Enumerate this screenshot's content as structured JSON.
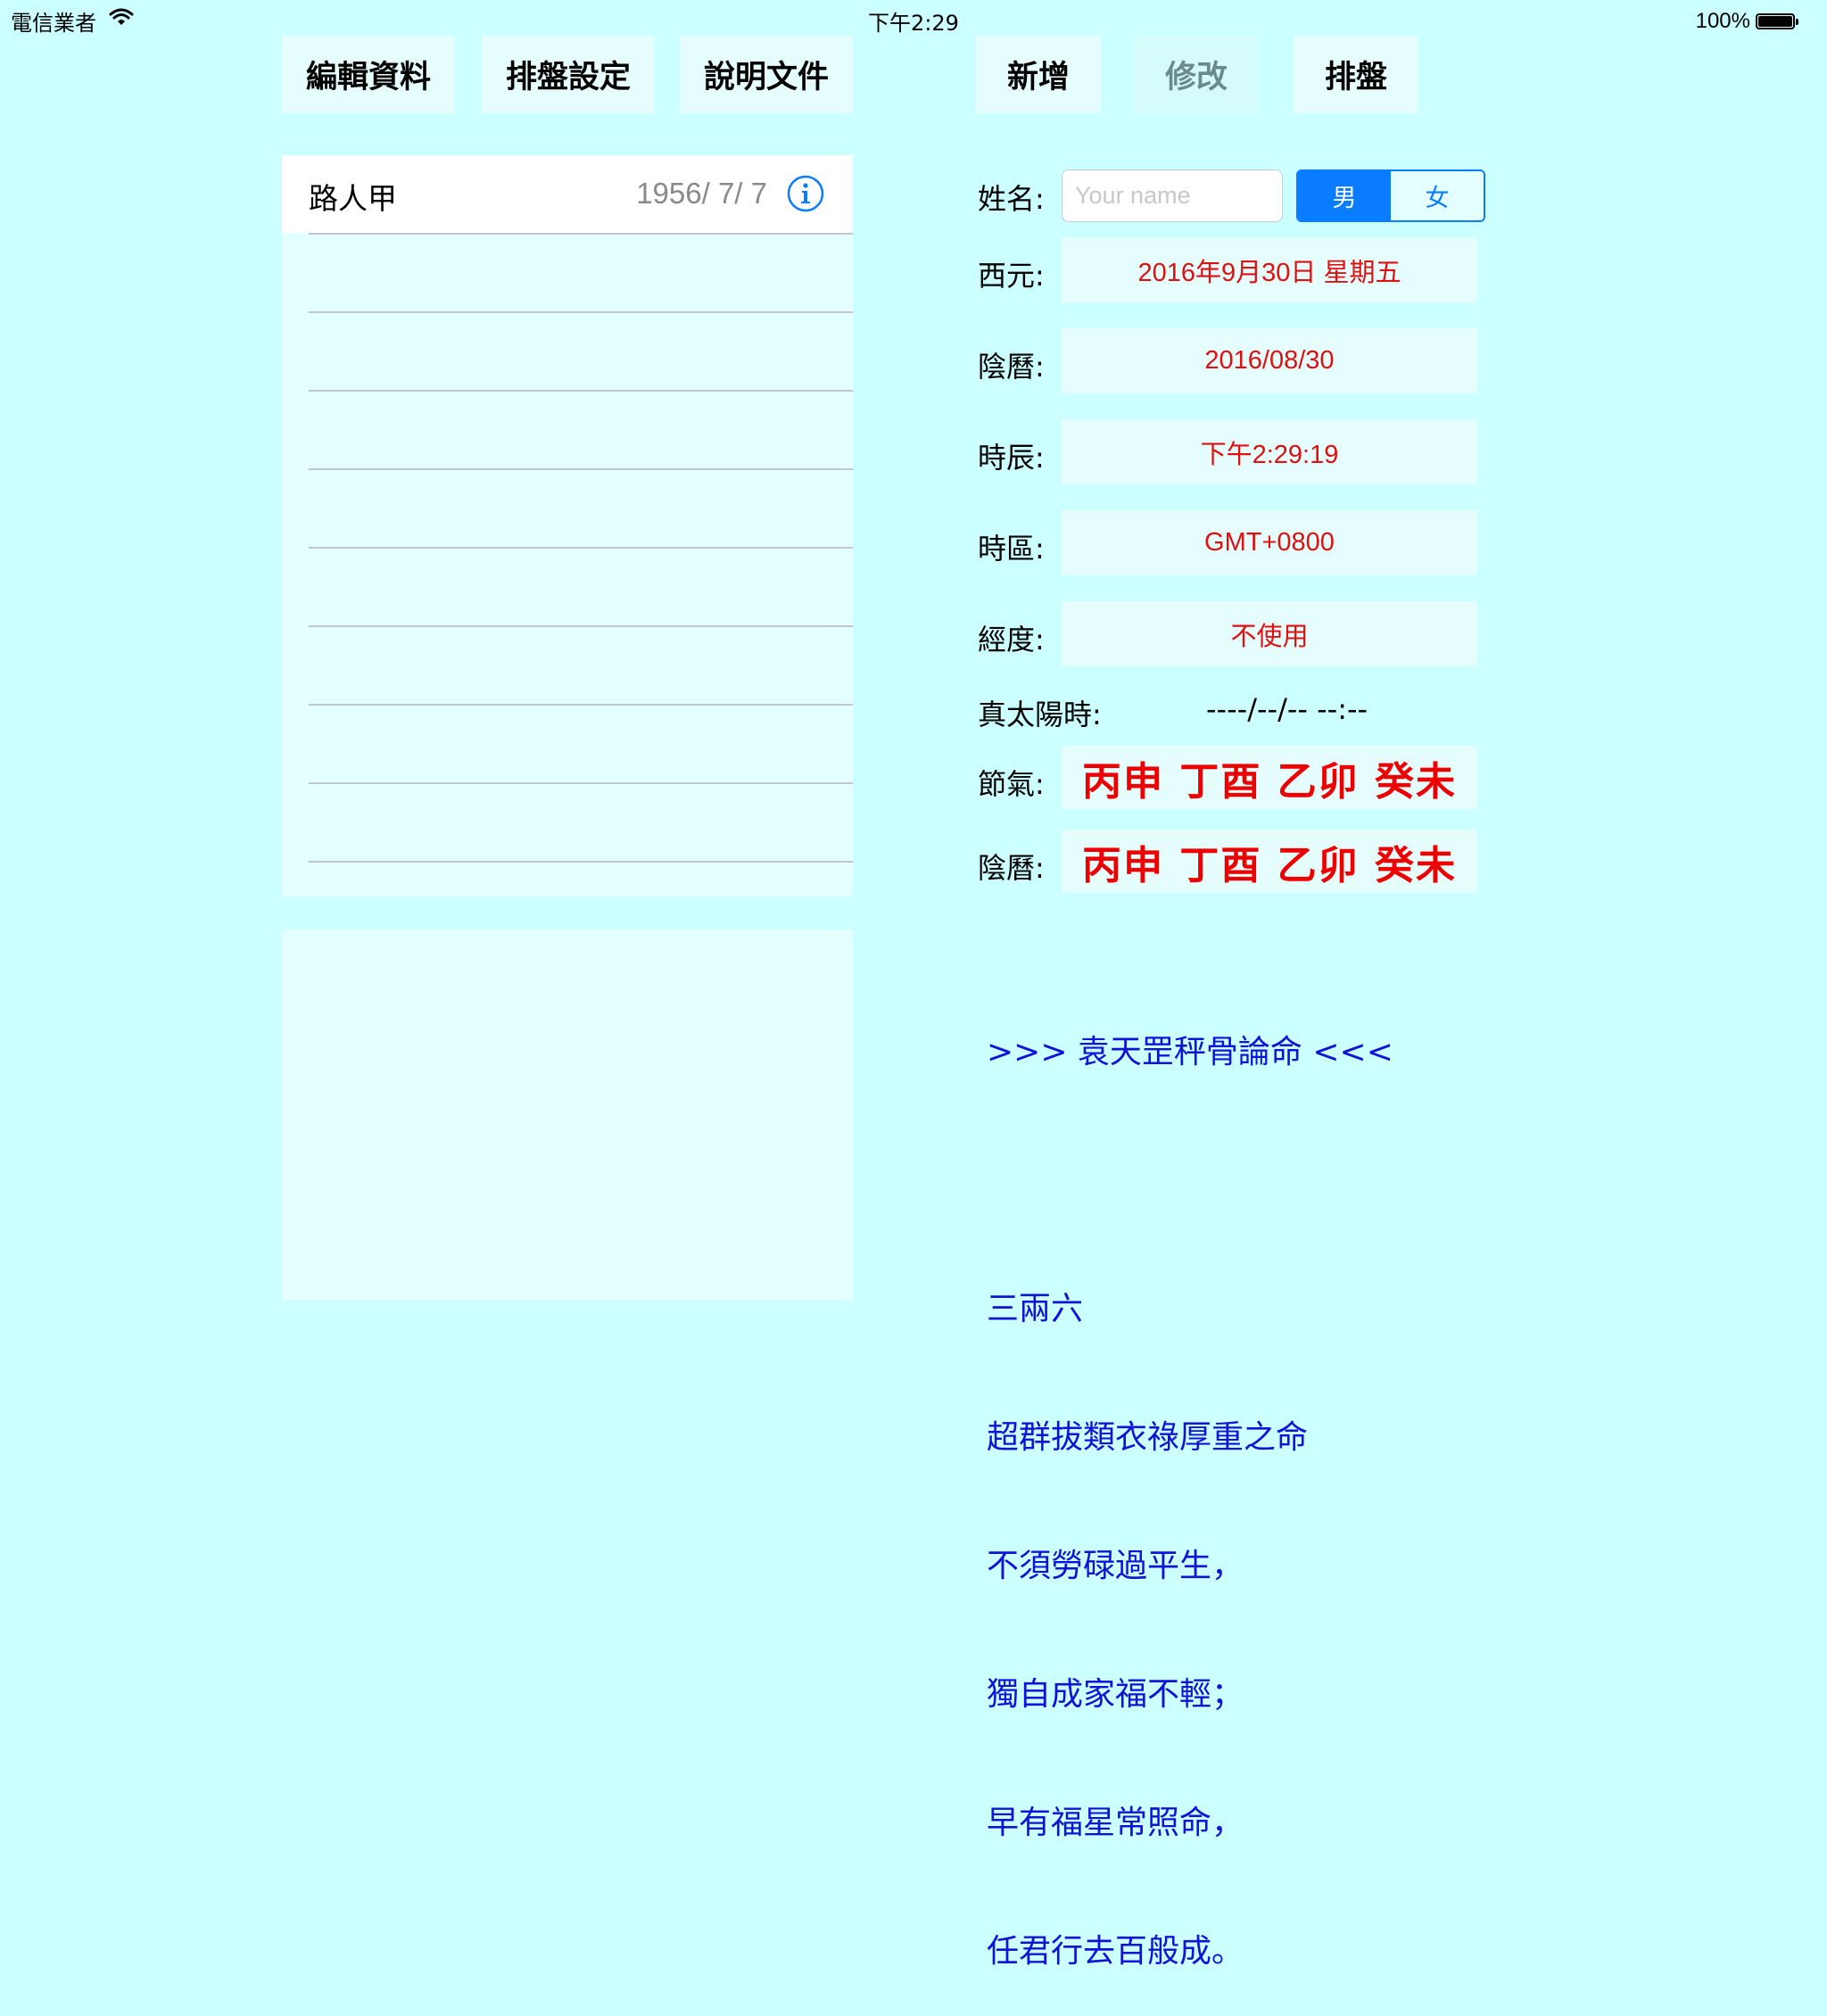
{
  "status_bar": {
    "carrier": "電信業者",
    "time": "下午2:29",
    "battery": "100%",
    "battery_level": 1.0,
    "icons": [
      "wifi-icon",
      "battery-icon"
    ]
  },
  "toolbar_left": [
    {
      "label": "編輯資料",
      "enabled": true
    },
    {
      "label": "排盤設定",
      "enabled": true
    },
    {
      "label": "說明文件",
      "enabled": true
    }
  ],
  "toolbar_right": [
    {
      "label": "新增",
      "enabled": true
    },
    {
      "label": "修改",
      "enabled": false
    },
    {
      "label": "排盤",
      "enabled": true
    }
  ],
  "records": [
    {
      "name": "路人甲",
      "date": "1956/ 7/ 7",
      "icon": "info-icon"
    }
  ],
  "form": {
    "name_label": "姓名:",
    "name_value": "",
    "name_placeholder": "Your name",
    "gender_options": [
      "男",
      "女"
    ],
    "gender_selected": "男",
    "fields": [
      {
        "label": "西元:",
        "value": "2016年9月30日 星期五"
      },
      {
        "label": "陰曆:",
        "value": "2016/08/30"
      },
      {
        "label": "時辰:",
        "value": "下午2:29:19"
      },
      {
        "label": "時區:",
        "value": "GMT+0800"
      },
      {
        "label": "經度:",
        "value": "不使用"
      }
    ],
    "true_solar_label": "真太陽時:",
    "true_solar_value": "----/--/-- --:--",
    "ganzhi": [
      {
        "label": "節氣:",
        "value": "丙申 丁酉 乙卯 癸未"
      },
      {
        "label": "陰曆:",
        "value": "丙申 丁酉 乙卯 癸未"
      }
    ]
  },
  "reading": {
    "title": ">>> 袁天罡秤骨論命 <<<",
    "weight": "三兩六",
    "lines": [
      "超群拔類衣祿厚重之命",
      "不須勞碌過平生，",
      "獨自成家福不輕；",
      "早有福星常照命，",
      "任君行去百般成。"
    ]
  },
  "colors": {
    "background": "#ccffff",
    "panel": "#e3ffff",
    "value_red": "#e01010",
    "accent_blue": "#0a7cff",
    "poem_blue": "#0f12d8"
  }
}
